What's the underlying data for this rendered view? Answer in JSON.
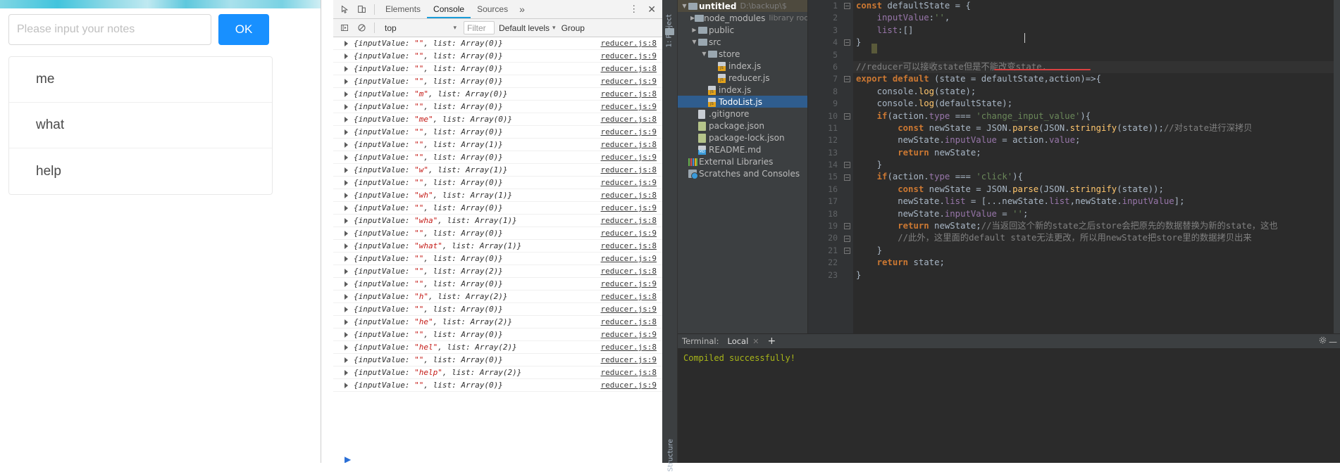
{
  "browser_page": {
    "input": {
      "placeholder": "Please input your notes",
      "value": ""
    },
    "ok_button": "OK",
    "todo_items": [
      "me",
      "what",
      "help"
    ],
    "accent_color": "#1890ff"
  },
  "devtools": {
    "icons": {
      "inspect": "inspect-element-icon",
      "device": "device-toolbar-icon"
    },
    "tabs": [
      {
        "label": "Elements",
        "active": false
      },
      {
        "label": "Console",
        "active": true
      },
      {
        "label": "Sources",
        "active": false
      }
    ],
    "more_tabs": "»",
    "menu_dots": "⋮",
    "close": "✕",
    "filterbar": {
      "execute_icon": "execute-snippet-icon",
      "clear_icon": "clear-console-icon",
      "context": "top",
      "context_caret": "▾",
      "filter_placeholder": "Filter",
      "levels": "Default levels",
      "levels_caret": "▾",
      "group_similar": "Group"
    },
    "log_entries": [
      {
        "value": "",
        "list": "Array(0)",
        "src": "reducer.js:8"
      },
      {
        "value": "",
        "list": "Array(0)",
        "src": "reducer.js:9"
      },
      {
        "value": "",
        "list": "Array(0)",
        "src": "reducer.js:8"
      },
      {
        "value": "",
        "list": "Array(0)",
        "src": "reducer.js:9"
      },
      {
        "value": "m",
        "list": "Array(0)",
        "src": "reducer.js:8"
      },
      {
        "value": "",
        "list": "Array(0)",
        "src": "reducer.js:9"
      },
      {
        "value": "me",
        "list": "Array(0)",
        "src": "reducer.js:8"
      },
      {
        "value": "",
        "list": "Array(0)",
        "src": "reducer.js:9"
      },
      {
        "value": "",
        "list": "Array(1)",
        "src": "reducer.js:8"
      },
      {
        "value": "",
        "list": "Array(0)",
        "src": "reducer.js:9"
      },
      {
        "value": "w",
        "list": "Array(1)",
        "src": "reducer.js:8"
      },
      {
        "value": "",
        "list": "Array(0)",
        "src": "reducer.js:9"
      },
      {
        "value": "wh",
        "list": "Array(1)",
        "src": "reducer.js:8"
      },
      {
        "value": "",
        "list": "Array(0)",
        "src": "reducer.js:9"
      },
      {
        "value": "wha",
        "list": "Array(1)",
        "src": "reducer.js:8"
      },
      {
        "value": "",
        "list": "Array(0)",
        "src": "reducer.js:9"
      },
      {
        "value": "what",
        "list": "Array(1)",
        "src": "reducer.js:8"
      },
      {
        "value": "",
        "list": "Array(0)",
        "src": "reducer.js:9"
      },
      {
        "value": "",
        "list": "Array(2)",
        "src": "reducer.js:8"
      },
      {
        "value": "",
        "list": "Array(0)",
        "src": "reducer.js:9"
      },
      {
        "value": "h",
        "list": "Array(2)",
        "src": "reducer.js:8"
      },
      {
        "value": "",
        "list": "Array(0)",
        "src": "reducer.js:9"
      },
      {
        "value": "he",
        "list": "Array(2)",
        "src": "reducer.js:8"
      },
      {
        "value": "",
        "list": "Array(0)",
        "src": "reducer.js:9"
      },
      {
        "value": "hel",
        "list": "Array(2)",
        "src": "reducer.js:8"
      },
      {
        "value": "",
        "list": "Array(0)",
        "src": "reducer.js:9"
      },
      {
        "value": "help",
        "list": "Array(2)",
        "src": "reducer.js:8"
      },
      {
        "value": "",
        "list": "Array(0)",
        "src": "reducer.js:9"
      }
    ]
  },
  "ide": {
    "left_toolbar": {
      "project_label": "1: Project",
      "structure_label": "Structure"
    },
    "project_tree": [
      {
        "depth": 0,
        "label": "untitled",
        "suffix": "D:\\backup\\$",
        "icon": "folder-icon",
        "twisty": "▼",
        "selected": false,
        "head": true
      },
      {
        "depth": 1,
        "label": "node_modules",
        "suffix": "library root",
        "icon": "folder-icon",
        "twisty": "▶",
        "selected": false,
        "head": false
      },
      {
        "depth": 1,
        "label": "public",
        "suffix": "",
        "icon": "folder-icon",
        "twisty": "▶",
        "selected": false,
        "head": false
      },
      {
        "depth": 1,
        "label": "src",
        "suffix": "",
        "icon": "folder-icon",
        "twisty": "▼",
        "selected": false,
        "head": false
      },
      {
        "depth": 2,
        "label": "store",
        "suffix": "",
        "icon": "folder-icon",
        "twisty": "▼",
        "selected": false,
        "head": false
      },
      {
        "depth": 3,
        "label": "index.js",
        "suffix": "",
        "icon": "js-file-icon",
        "twisty": "",
        "selected": false,
        "head": false
      },
      {
        "depth": 3,
        "label": "reducer.js",
        "suffix": "",
        "icon": "js-file-icon",
        "twisty": "",
        "selected": false,
        "head": false
      },
      {
        "depth": 2,
        "label": "index.js",
        "suffix": "",
        "icon": "js-file-icon",
        "twisty": "",
        "selected": false,
        "head": false
      },
      {
        "depth": 2,
        "label": "TodoList.js",
        "suffix": "",
        "icon": "js-file-icon",
        "twisty": "",
        "selected": true,
        "head": false
      },
      {
        "depth": 1,
        "label": ".gitignore",
        "suffix": "",
        "icon": "text-file-icon",
        "twisty": "",
        "selected": false,
        "head": false
      },
      {
        "depth": 1,
        "label": "package.json",
        "suffix": "",
        "icon": "json-file-icon",
        "twisty": "",
        "selected": false,
        "head": false
      },
      {
        "depth": 1,
        "label": "package-lock.json",
        "suffix": "",
        "icon": "json-file-icon",
        "twisty": "",
        "selected": false,
        "head": false
      },
      {
        "depth": 1,
        "label": "README.md",
        "suffix": "",
        "icon": "md-file-icon",
        "twisty": "",
        "selected": false,
        "head": false
      },
      {
        "depth": 0,
        "label": "External Libraries",
        "suffix": "",
        "icon": "libraries-icon",
        "twisty": "",
        "selected": false,
        "head": false
      },
      {
        "depth": 0,
        "label": "Scratches and Consoles",
        "suffix": "",
        "icon": "scratches-icon",
        "twisty": "",
        "selected": false,
        "head": false
      }
    ],
    "editor": {
      "line_numbers": [
        "1",
        "2",
        "3",
        "4",
        "5",
        "6",
        "7",
        "8",
        "9",
        "10",
        "11",
        "12",
        "13",
        "14",
        "15",
        "16",
        "17",
        "18",
        "19",
        "20",
        "21",
        "22",
        "23"
      ],
      "lines": [
        "const defaultState = {",
        "    inputValue:'',",
        "    list:[]",
        "}",
        "",
        "//reducer可以接收state但是不能改变state.",
        "export default (state = defaultState,action)=>{",
        "    console.log(state);",
        "    console.log(defaultState);",
        "    if(action.type === 'change_input_value'){",
        "        const newState = JSON.parse(JSON.stringify(state));//对state进行深拷贝",
        "        newState.inputValue = action.value;",
        "        return newState;",
        "    }",
        "    if(action.type === 'click'){",
        "        const newState = JSON.parse(JSON.stringify(state));",
        "        newState.list = [...newState.list,newState.inputValue];",
        "        newState.inputValue = '';",
        "        return newState;//当返回这个新的state之后store会把原先的数据替换为新的state，这也",
        "        //此外，这里面的default state无法更改，所以用newState把store里的数据拷贝出来",
        "    }",
        "    return state;",
        "}"
      ]
    },
    "terminal": {
      "label": "Terminal:",
      "tab": "Local",
      "tab_close": "✕",
      "add": "+",
      "settings_icon": "gear-icon",
      "minimize_icon": "minimize-icon",
      "output": [
        "Compiled successfully!"
      ]
    }
  }
}
